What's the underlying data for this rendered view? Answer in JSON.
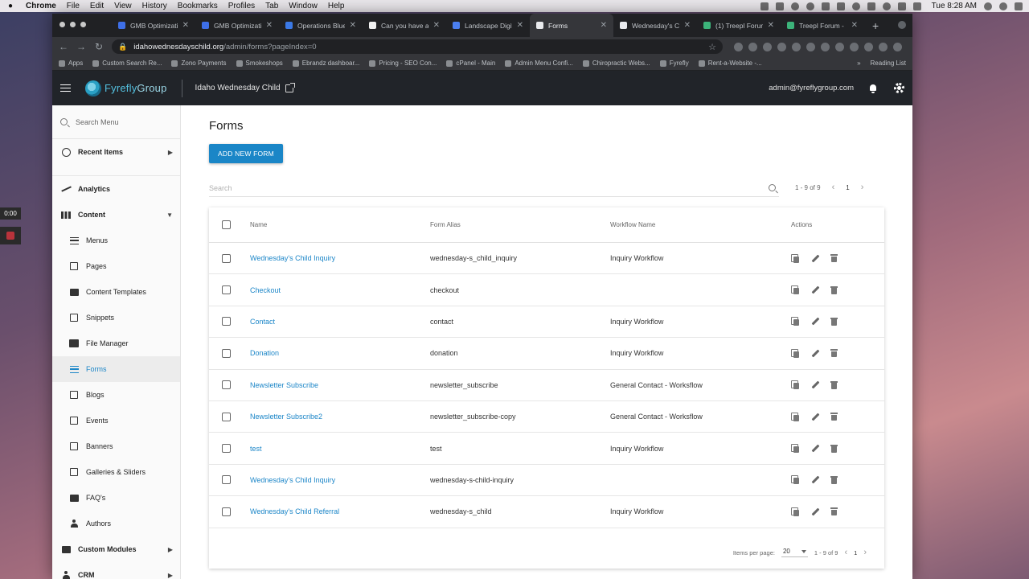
{
  "menubar": {
    "app": "Chrome",
    "items": [
      "File",
      "Edit",
      "View",
      "History",
      "Bookmarks",
      "Profiles",
      "Tab",
      "Window",
      "Help"
    ],
    "clock": "Tue 8:28 AM"
  },
  "recorder": {
    "timer": "0:00"
  },
  "browser": {
    "tabs": [
      {
        "label": "GMB Optimizatio",
        "favicon": "#3e6fe8",
        "active": false
      },
      {
        "label": "GMB Optimizatio",
        "favicon": "#3e6fe8",
        "active": false
      },
      {
        "label": "Operations Blue",
        "favicon": "#3b79e6",
        "active": false
      },
      {
        "label": "Can you have a",
        "favicon": "#f1f1f1",
        "active": false
      },
      {
        "label": "Landscape Digit",
        "favicon": "#4b7ff0",
        "active": false
      },
      {
        "label": "Forms",
        "favicon": "#e8eaed",
        "active": true
      },
      {
        "label": "Wednesday's Ch",
        "favicon": "#e8eaed",
        "active": false
      },
      {
        "label": "(1) Treepl Forum",
        "favicon": "#3cb37a",
        "active": false
      },
      {
        "label": "Treepl Forum -",
        "favicon": "#3cb37a",
        "active": false
      }
    ],
    "url_host": "idahowednesdayschild.org",
    "url_path": "/admin/forms?pageIndex=0",
    "bookmarks": [
      "Apps",
      "Custom Search Re...",
      "Zono Payments",
      "Smokeshops",
      "Ebrandz dashboar...",
      "Pricing - SEO Con...",
      "cPanel - Main",
      "Admin Menu Confi...",
      "Chiropractic Webs...",
      "Fyrefly",
      "Rent-a-Website -..."
    ],
    "bookmarks_more": "»",
    "reading_list": "Reading List"
  },
  "appbar": {
    "logo_text_1": "Fyrefly",
    "logo_text_2": "Group",
    "site_name": "Idaho Wednesday Child",
    "user": "admin@fyreflygroup.com"
  },
  "sidebar": {
    "search_placeholder": "Search Menu",
    "recent": "Recent Items",
    "analytics": "Analytics",
    "content": "Content",
    "items": [
      {
        "label": "Menus",
        "icon": "menu-lines-icon"
      },
      {
        "label": "Pages",
        "icon": "page-icon"
      },
      {
        "label": "Content Templates",
        "icon": "template-icon"
      },
      {
        "label": "Snippets",
        "icon": "snippet-icon"
      },
      {
        "label": "File Manager",
        "icon": "image-folder-icon"
      },
      {
        "label": "Forms",
        "icon": "forms-icon",
        "active": true
      },
      {
        "label": "Blogs",
        "icon": "blog-icon"
      },
      {
        "label": "Events",
        "icon": "events-icon"
      },
      {
        "label": "Banners",
        "icon": "banner-icon"
      },
      {
        "label": "Galleries & Sliders",
        "icon": "gallery-icon"
      },
      {
        "label": "FAQ's",
        "icon": "faq-icon"
      },
      {
        "label": "Authors",
        "icon": "person-icon"
      }
    ],
    "custom_modules": "Custom Modules",
    "crm": "CRM"
  },
  "main": {
    "title": "Forms",
    "add_button": "ADD NEW FORM",
    "search_placeholder": "Search",
    "range": "1 - 9 of 9",
    "page": "1",
    "columns": {
      "name": "Name",
      "alias": "Form Alias",
      "workflow": "Workflow Name",
      "actions": "Actions"
    },
    "rows": [
      {
        "name": "Wednesday's Child Inquiry",
        "alias": "wednesday-s_child_inquiry",
        "workflow": "Inquiry Workflow"
      },
      {
        "name": "Checkout",
        "alias": "checkout",
        "workflow": ""
      },
      {
        "name": "Contact",
        "alias": "contact",
        "workflow": "Inquiry Workflow"
      },
      {
        "name": "Donation",
        "alias": "donation",
        "workflow": "Inquiry Workflow"
      },
      {
        "name": "Newsletter Subscribe",
        "alias": "newsletter_subscribe",
        "workflow": "General Contact - Worksflow"
      },
      {
        "name": "Newsletter Subscribe2",
        "alias": "newsletter_subscribe-copy",
        "workflow": "General Contact - Worksflow"
      },
      {
        "name": "test",
        "alias": "test",
        "workflow": "Inquiry Workflow"
      },
      {
        "name": "Wednesday's Child Inquiry",
        "alias": "wednesday-s-child-inquiry",
        "workflow": ""
      },
      {
        "name": "Wednesday's Child Referral",
        "alias": "wednesday-s_child",
        "workflow": "Inquiry Workflow"
      }
    ],
    "items_per_page_label": "Items per page:",
    "items_per_page": "20",
    "footer_range": "1 - 9 of 9",
    "footer_page": "1"
  }
}
